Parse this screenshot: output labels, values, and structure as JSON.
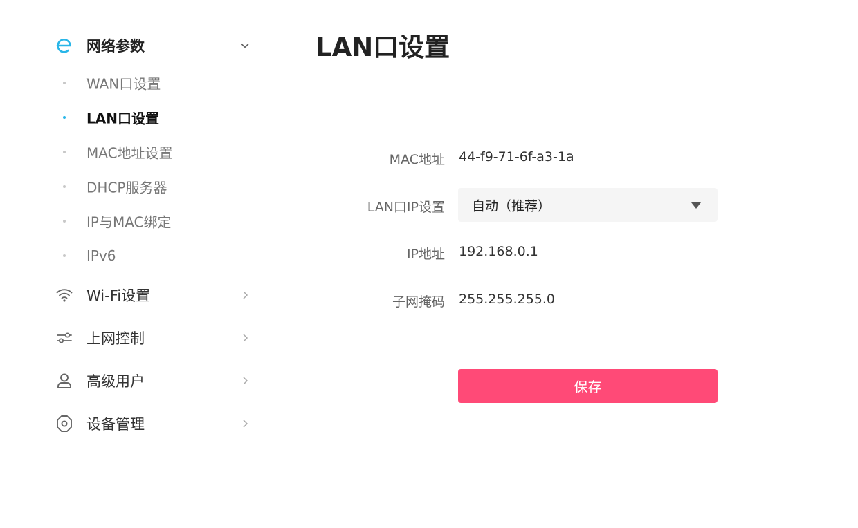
{
  "sidebar": {
    "network": {
      "label": "网络参数",
      "icon": "network-e-icon",
      "expanded": true,
      "items": [
        {
          "label": "WAN口设置",
          "active": false
        },
        {
          "label": "LAN口设置",
          "active": true
        },
        {
          "label": "MAC地址设置",
          "active": false
        },
        {
          "label": "DHCP服务器",
          "active": false
        },
        {
          "label": "IP与MAC绑定",
          "active": false
        },
        {
          "label": "IPv6",
          "active": false
        }
      ]
    },
    "wifi": {
      "label": "Wi-Fi设置",
      "icon": "wifi-icon"
    },
    "access": {
      "label": "上网控制",
      "icon": "sliders-icon"
    },
    "users": {
      "label": "高级用户",
      "icon": "user-icon"
    },
    "device": {
      "label": "设备管理",
      "icon": "gear-icon"
    }
  },
  "main": {
    "title": "LAN口设置",
    "fields": {
      "mac": {
        "label": "MAC地址",
        "value": "44-f9-71-6f-a3-1a"
      },
      "ip_mode": {
        "label": "LAN口IP设置",
        "value": "自动（推荐）"
      },
      "ip": {
        "label": "IP地址",
        "value": "192.168.0.1"
      },
      "mask": {
        "label": "子网掩码",
        "value": "255.255.255.0"
      }
    },
    "save_label": "保存"
  },
  "colors": {
    "accent": "#29b6e8",
    "primary_button": "#ff4a77",
    "select_bg": "#f5f5f5"
  }
}
